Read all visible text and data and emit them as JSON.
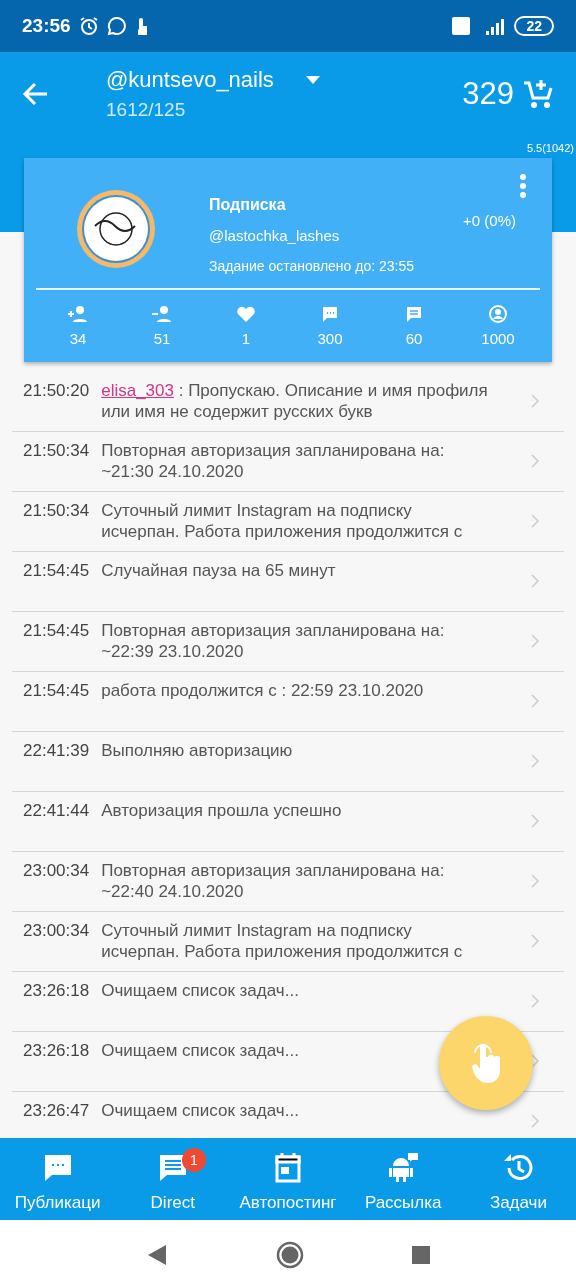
{
  "status_bar": {
    "time": "23:56",
    "battery": "22"
  },
  "app_bar": {
    "account": "@kuntsevo_nails",
    "counts": "1612/125",
    "balance": "329"
  },
  "version": "5.5(1042)",
  "task_card": {
    "title": "Подписка",
    "target": "@lastochka_lashes",
    "progress": "+0 (0%)",
    "note": "Задание остановлено до: 23:55",
    "stats": [
      {
        "kind": "follow",
        "value": "34"
      },
      {
        "kind": "unfollow",
        "value": "51"
      },
      {
        "kind": "like",
        "value": "1"
      },
      {
        "kind": "comment",
        "value": "300"
      },
      {
        "kind": "message",
        "value": "60"
      },
      {
        "kind": "profile",
        "value": "1000"
      }
    ]
  },
  "log": [
    {
      "time": "21:50:20",
      "user": "elisa_303",
      "text": " : Пропускаю. Описание и имя профиля или имя не содержит русских букв"
    },
    {
      "time": "21:50:34",
      "text": "Повторная авторизация запланирована на: ~21:30 24.10.2020"
    },
    {
      "time": "21:50:34",
      "text": "Суточный лимит Instagram на подписку исчерпан. Работа приложения продолжится с"
    },
    {
      "time": "21:54:45",
      "text": "Случайная пауза на 65 минут"
    },
    {
      "time": "21:54:45",
      "text": "Повторная авторизация запланирована на: ~22:39 23.10.2020"
    },
    {
      "time": "21:54:45",
      "text": "работа продолжится с : 22:59 23.10.2020"
    },
    {
      "time": "22:41:39",
      "text": "Выполняю авторизацию"
    },
    {
      "time": "22:41:44",
      "text": "Авторизация прошла успешно"
    },
    {
      "time": "23:00:34",
      "text": "Повторная авторизация запланирована на: ~22:40 24.10.2020"
    },
    {
      "time": "23:00:34",
      "text": "Суточный лимит Instagram на подписку исчерпан. Работа приложения продолжится с"
    },
    {
      "time": "23:26:18",
      "text": "Очищаем список задач..."
    },
    {
      "time": "23:26:18",
      "text": "Очищаем список задач..."
    },
    {
      "time": "23:26:47",
      "text": "Очищаем список задач..."
    }
  ],
  "bottom_nav": [
    {
      "kind": "posts",
      "label": "Публикаци"
    },
    {
      "kind": "direct",
      "label": "Direct",
      "badge": "1"
    },
    {
      "kind": "autopost",
      "label": "Автопостинг"
    },
    {
      "kind": "mailing",
      "label": "Рассылка"
    },
    {
      "kind": "tasks",
      "label": "Задачи"
    }
  ]
}
